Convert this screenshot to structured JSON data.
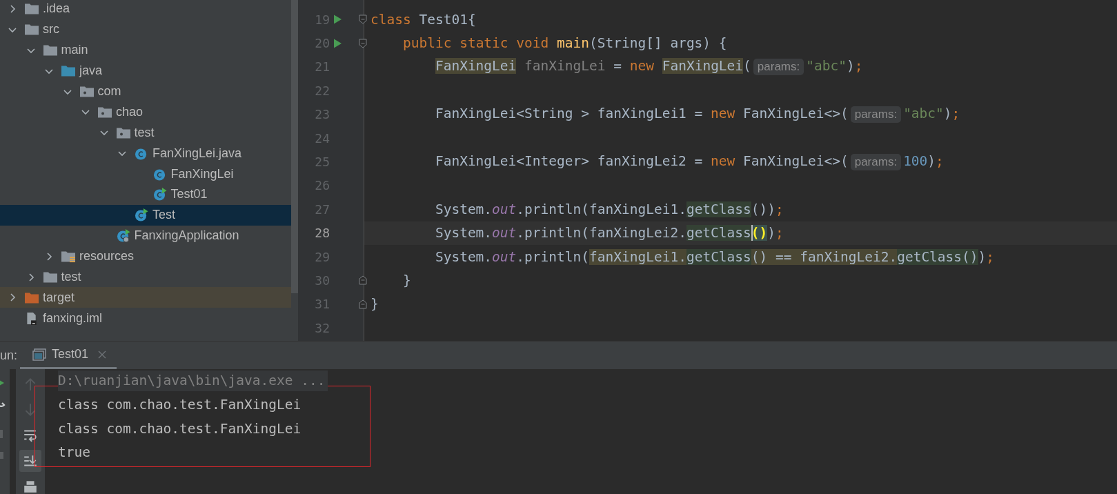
{
  "project_tree": [
    {
      "label": ".idea",
      "kind": "folder",
      "expanded": false,
      "selected": false
    },
    {
      "label": "src",
      "kind": "folder",
      "expanded": true,
      "selected": false,
      "children": [
        {
          "label": "main",
          "kind": "folder",
          "expanded": true,
          "selected": false,
          "children": [
            {
              "label": "java",
              "kind": "source",
              "expanded": true,
              "selected": false,
              "children": [
                {
                  "label": "com",
                  "kind": "package",
                  "expanded": true,
                  "selected": false,
                  "children": [
                    {
                      "label": "chao",
                      "kind": "package",
                      "expanded": true,
                      "selected": false,
                      "children": [
                        {
                          "label": "test",
                          "kind": "package",
                          "expanded": true,
                          "selected": false,
                          "children": [
                            {
                              "label": "FanXingLei.java",
                              "kind": "class",
                              "expanded": true,
                              "selected": false,
                              "children": [
                                {
                                  "label": "FanXingLei",
                                  "kind": "class",
                                  "selected": false
                                },
                                {
                                  "label": "Test01",
                                  "kind": "runnable",
                                  "selected": false
                                }
                              ]
                            },
                            {
                              "label": "Test",
                              "kind": "runnable",
                              "selected": true
                            }
                          ]
                        },
                        {
                          "label": "FanxingApplication",
                          "kind": "application",
                          "selected": false
                        }
                      ]
                    }
                  ]
                }
              ]
            },
            {
              "label": "resources",
              "kind": "resources",
              "expanded": false,
              "selected": false
            }
          ]
        },
        {
          "label": "test",
          "kind": "folder",
          "expanded": false,
          "selected": false
        }
      ]
    },
    {
      "label": "target",
      "kind": "excluded",
      "expanded": false,
      "selected": false
    },
    {
      "label": "fanxing.iml",
      "kind": "module",
      "selected": false
    }
  ],
  "editor": {
    "lines": [
      {
        "number": "19",
        "run": true,
        "kind": "fold-start",
        "current": false,
        "tokens": [
          {
            "text": "class",
            "kind": "keyword"
          },
          {
            "text": " Test01{",
            "kind": "plain"
          }
        ]
      },
      {
        "number": "20",
        "run": true,
        "kind": "fold-start",
        "current": false,
        "tokens": [
          {
            "text": "    public static void ",
            "kind": "keyword"
          },
          {
            "text": "main",
            "kind": "method"
          },
          {
            "text": "(String[] args) {",
            "kind": "plain"
          }
        ]
      },
      {
        "number": "21",
        "run": false,
        "kind": "code",
        "current": false,
        "tokens": [
          {
            "text": "        FanXingLei",
            "kind": "usage"
          },
          {
            "text": " fanXingLei",
            "kind": "unused"
          },
          {
            "text": " = ",
            "kind": "plain"
          },
          {
            "text": "new ",
            "kind": "keyword"
          },
          {
            "text": "FanXingLei",
            "kind": "usage"
          },
          {
            "text": "(",
            "kind": "plain"
          },
          {
            "text": "params:",
            "kind": "hint"
          },
          {
            "text": "\"abc\"",
            "kind": "string"
          },
          {
            "text": ")",
            "kind": "plain"
          },
          {
            "text": ";",
            "kind": "punct"
          }
        ]
      },
      {
        "number": "22",
        "run": false,
        "kind": "code",
        "current": false
      },
      {
        "number": "23",
        "run": false,
        "kind": "code",
        "current": false,
        "tokens": [
          {
            "text": "        FanXingLei<String > fanXingLei1 = ",
            "kind": "plain"
          },
          {
            "text": "new",
            "kind": "keyword"
          },
          {
            "text": " FanXingLei<>(",
            "kind": "plain"
          },
          {
            "text": "params:",
            "kind": "hint"
          },
          {
            "text": "\"abc\"",
            "kind": "string"
          },
          {
            "text": ")",
            "kind": "plain"
          },
          {
            "text": ";",
            "kind": "punct"
          }
        ]
      },
      {
        "number": "24",
        "run": false,
        "kind": "code",
        "current": false
      },
      {
        "number": "25",
        "run": false,
        "kind": "code",
        "current": false,
        "tokens": [
          {
            "text": "        FanXingLei<Integer> fanXingLei2 = ",
            "kind": "plain"
          },
          {
            "text": "new",
            "kind": "keyword"
          },
          {
            "text": " FanXingLei<>(",
            "kind": "plain"
          },
          {
            "text": "params:",
            "kind": "hint"
          },
          {
            "text": "100",
            "kind": "number"
          },
          {
            "text": ")",
            "kind": "plain"
          },
          {
            "text": ";",
            "kind": "punct"
          }
        ]
      },
      {
        "number": "26",
        "run": false,
        "kind": "code",
        "current": false
      },
      {
        "number": "27",
        "run": false,
        "kind": "code",
        "current": false,
        "tokens": [
          {
            "text": "        System.",
            "kind": "plain"
          },
          {
            "text": "out",
            "kind": "field"
          },
          {
            "text": ".println(fanXingLei1.",
            "kind": "plain"
          },
          {
            "text": "getClass",
            "kind": "read"
          },
          {
            "text": "())",
            "kind": "plain"
          },
          {
            "text": ";",
            "kind": "punct"
          }
        ]
      },
      {
        "number": "28",
        "run": false,
        "kind": "code",
        "current": true,
        "tokens": [
          {
            "text": "        System.",
            "kind": "plain"
          },
          {
            "text": "out",
            "kind": "field"
          },
          {
            "text": ".println(fanXingLei2.",
            "kind": "plain"
          },
          {
            "text": "getClass",
            "kind": "read"
          },
          {
            "text": "()",
            "kind": "brace",
            "caret": true
          },
          {
            "text": ")",
            "kind": "plain"
          },
          {
            "text": ";",
            "kind": "punct"
          }
        ]
      },
      {
        "number": "29",
        "run": false,
        "kind": "code",
        "current": false,
        "tokens": [
          {
            "text": "        System.",
            "kind": "plain"
          },
          {
            "text": "out",
            "kind": "field"
          },
          {
            "text": ".println(",
            "kind": "plain"
          },
          {
            "text": "fanXingLei1.",
            "kind": "usage"
          },
          {
            "text": "getClass",
            "kind": "read"
          },
          {
            "text": "() == fanXingLei2.",
            "kind": "usage"
          },
          {
            "text": "getClass()",
            "kind": "read"
          },
          {
            "text": ")",
            "kind": "plain"
          },
          {
            "text": ";",
            "kind": "punct"
          }
        ]
      },
      {
        "number": "30",
        "run": false,
        "kind": "fold-end",
        "current": false,
        "tokens": [
          {
            "text": "    }",
            "kind": "plain"
          }
        ]
      },
      {
        "number": "31",
        "run": false,
        "kind": "fold-end",
        "current": false,
        "tokens": [
          {
            "text": "}",
            "kind": "plain"
          }
        ]
      },
      {
        "number": "32",
        "run": false,
        "kind": "code",
        "current": false
      }
    ]
  },
  "run_panel": {
    "label": "un:",
    "tabs": [
      {
        "label": "Test01",
        "selected": true
      }
    ],
    "console": [
      {
        "text": "D:\\ruanjian\\java\\bin\\java.exe ...",
        "kind": "command"
      },
      {
        "text": "class com.chao.test.FanXingLei",
        "kind": "output"
      },
      {
        "text": "class com.chao.test.FanXingLei",
        "kind": "output"
      },
      {
        "text": "true",
        "kind": "output"
      }
    ]
  }
}
